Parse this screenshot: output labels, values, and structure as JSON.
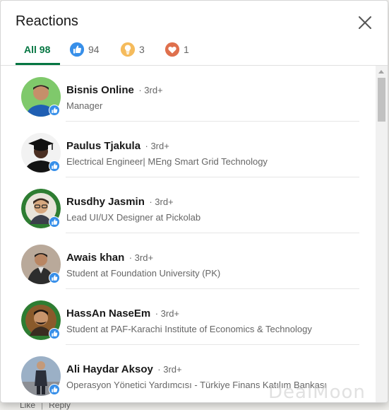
{
  "modal": {
    "title": "Reactions",
    "tabs": [
      {
        "label": "All 98",
        "icon": "all"
      },
      {
        "label": "94",
        "icon": "like-icon"
      },
      {
        "label": "3",
        "icon": "insightful-icon"
      },
      {
        "label": "1",
        "icon": "love-icon"
      }
    ]
  },
  "reactors": [
    {
      "name": "Bisnis Online",
      "degree": "· 3rd+",
      "headline": "Manager",
      "reaction": "like-icon"
    },
    {
      "name": "Paulus Tjakula",
      "degree": "· 3rd+",
      "headline": "Electrical Engineer| MEng Smart Grid Technology",
      "reaction": "like-icon"
    },
    {
      "name": "Rusdhy Jasmin",
      "degree": "· 3rd+",
      "headline": "Lead UI/UX Designer at Pickolab",
      "reaction": "like-icon"
    },
    {
      "name": "Awais khan",
      "degree": "· 3rd+",
      "headline": "Student at Foundation University (PK)",
      "reaction": "like-icon"
    },
    {
      "name": "HassAn NaseEm",
      "degree": "· 3rd+",
      "headline": "Student at PAF-Karachi Institute of Economics & Technology",
      "reaction": "like-icon"
    },
    {
      "name": "Ali Haydar Aksoy",
      "degree": "· 3rd+",
      "headline": "Operasyon Yönetici Yardımcısı - Türkiye Finans Katılım Bankası",
      "reaction": "like-icon"
    }
  ],
  "backdrop": {
    "like_label": "Like",
    "separator": "|",
    "reply_label": "Reply"
  },
  "watermark": "DealMoon",
  "colors": {
    "accent": "#057642",
    "like": "#378fe9",
    "insightful": "#f5bb5c",
    "love": "#df704d"
  }
}
